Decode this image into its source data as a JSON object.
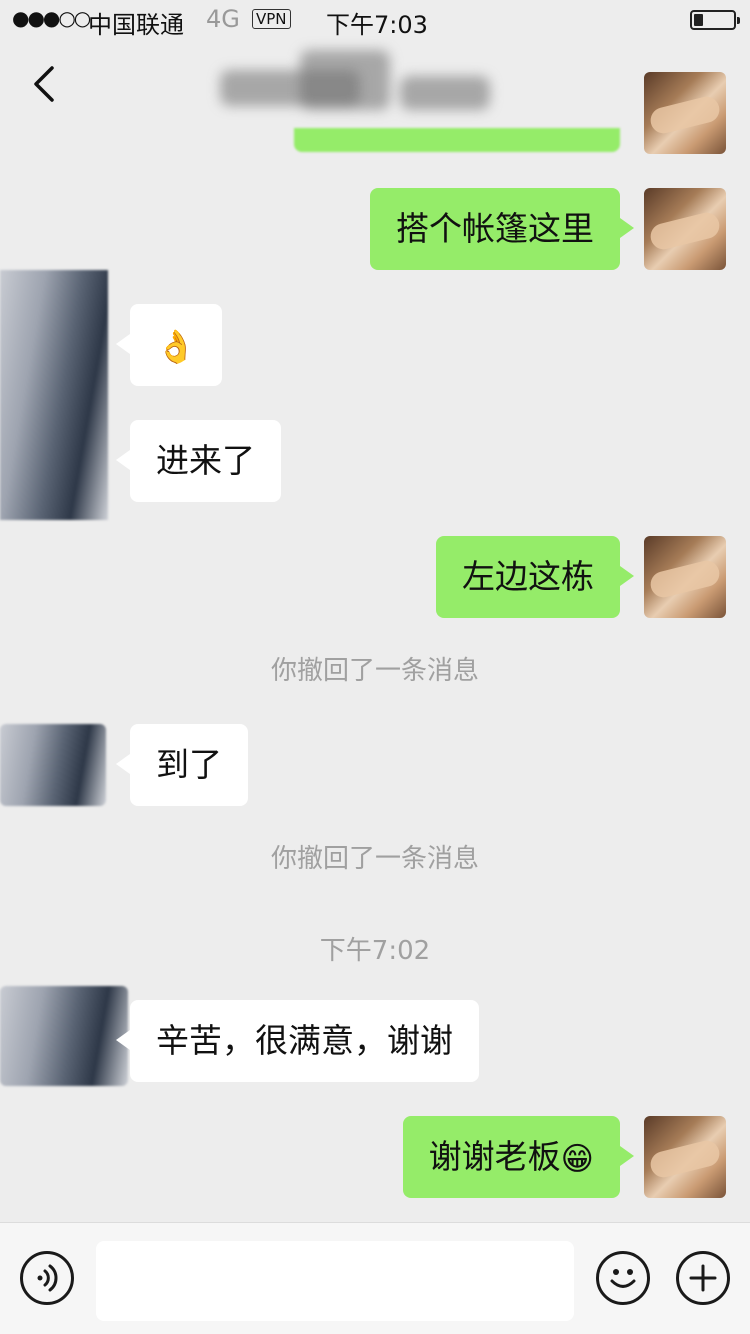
{
  "status_bar": {
    "signal": "●●●○○",
    "carrier": "中国联通",
    "network": "4G",
    "vpn": "VPN",
    "time": "下午7:03"
  },
  "nav": {
    "back_icon": "chevron-left-icon",
    "more_icon": "ellipsis-icon"
  },
  "messages": [
    {
      "side": "right",
      "text": "搭个帐篷这里"
    },
    {
      "side": "left",
      "text": "👌"
    },
    {
      "side": "left",
      "text": "进来了"
    },
    {
      "side": "right",
      "text": "左边这栋"
    },
    {
      "type": "system",
      "text": "你撤回了一条消息"
    },
    {
      "side": "left",
      "text": "到了"
    },
    {
      "type": "system",
      "text": "你撤回了一条消息"
    },
    {
      "type": "time",
      "text": "下午7:02"
    },
    {
      "side": "left",
      "text": "辛苦，很满意，谢谢"
    },
    {
      "side": "right",
      "text": "谢谢老板",
      "emoji": "😁"
    }
  ],
  "input_bar": {
    "voice_icon": "voice-icon",
    "text_value": "",
    "emoji_icon": "emoji-icon",
    "plus_icon": "plus-icon"
  },
  "colors": {
    "background": "#ededed",
    "sent_bubble": "#95ec69",
    "received_bubble": "#ffffff",
    "system_text": "#a0a0a0"
  }
}
